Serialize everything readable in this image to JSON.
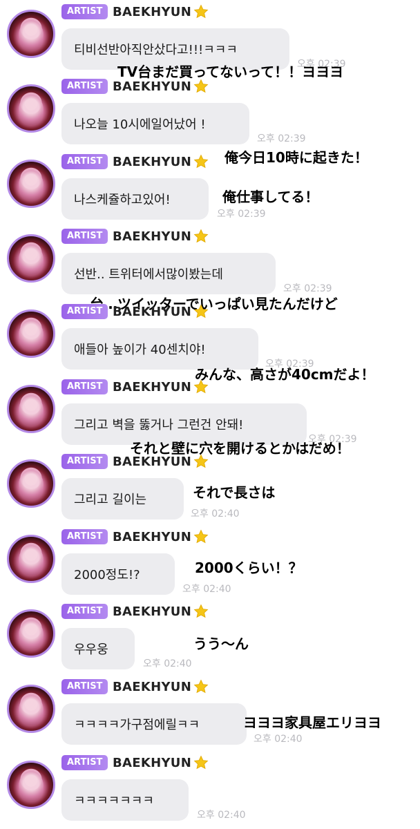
{
  "messages": [
    {
      "badge": "ARTIST",
      "name": "BAEKHYUN",
      "text": "티비선반아직안샀다고!!!ㅋㅋㅋ",
      "time": "오후 02:39",
      "translation": "TV台まだ買ってないって！！ヨヨヨ"
    },
    {
      "badge": "ARTIST",
      "name": "BAEKHYUN",
      "text": "나오늘 10시에일어났어 !",
      "time": "오후 02:39",
      "translation": "俺今日10時に起きた！"
    },
    {
      "badge": "ARTIST",
      "name": "BAEKHYUN",
      "text": "나스케쥴하고있어!",
      "time": "오후 02:39",
      "translation": "俺仕事してる！"
    },
    {
      "badge": "ARTIST",
      "name": "BAEKHYUN",
      "text": "선반.. 트위터에서많이봤는데",
      "time": "오후 02:39",
      "translation": "台…ツイッターでいっぱい見たんだけど"
    },
    {
      "badge": "ARTIST",
      "name": "BAEKHYUN",
      "text": "애들아 높이가 40센치야!",
      "time": "오후 02:39",
      "translation": "みんな、高さが40cmだよ！"
    },
    {
      "badge": "ARTIST",
      "name": "BAEKHYUN",
      "text": "그리고 벽을 뚫거나 그런건 안돼!",
      "time": "오후 02:39",
      "translation": "それと壁に穴を開けるとかはだめ！"
    },
    {
      "badge": "ARTIST",
      "name": "BAEKHYUN",
      "text": "그리고 길이는",
      "time": "오후 02:40",
      "translation": "それで長さは"
    },
    {
      "badge": "ARTIST",
      "name": "BAEKHYUN",
      "text": "2000정도!?",
      "time": "오후 02:40",
      "translation": "2000くらい！？"
    },
    {
      "badge": "ARTIST",
      "name": "BAEKHYUN",
      "text": "우우웅",
      "time": "오후 02:40",
      "translation": "うう〜ん"
    },
    {
      "badge": "ARTIST",
      "name": "BAEKHYUN",
      "text": "ㅋㅋㅋㅋ가구점에릴ㅋㅋ",
      "time": "오후 02:40",
      "translation": "ヨヨヨ家具屋エリヨヨ"
    },
    {
      "badge": "ARTIST",
      "name": "BAEKHYUN",
      "text": "ㅋㅋㅋㅋㅋㅋㅋ",
      "time": "오후 02:40",
      "translation": ""
    }
  ],
  "colors": {
    "badge": "#a274ec",
    "bubble": "#ececef",
    "timestamp": "#b9b9be",
    "avatar_ring": "#b48ae6",
    "star": "#f5c518"
  },
  "icons": {
    "star": "star-icon",
    "avatar": "avatar"
  }
}
